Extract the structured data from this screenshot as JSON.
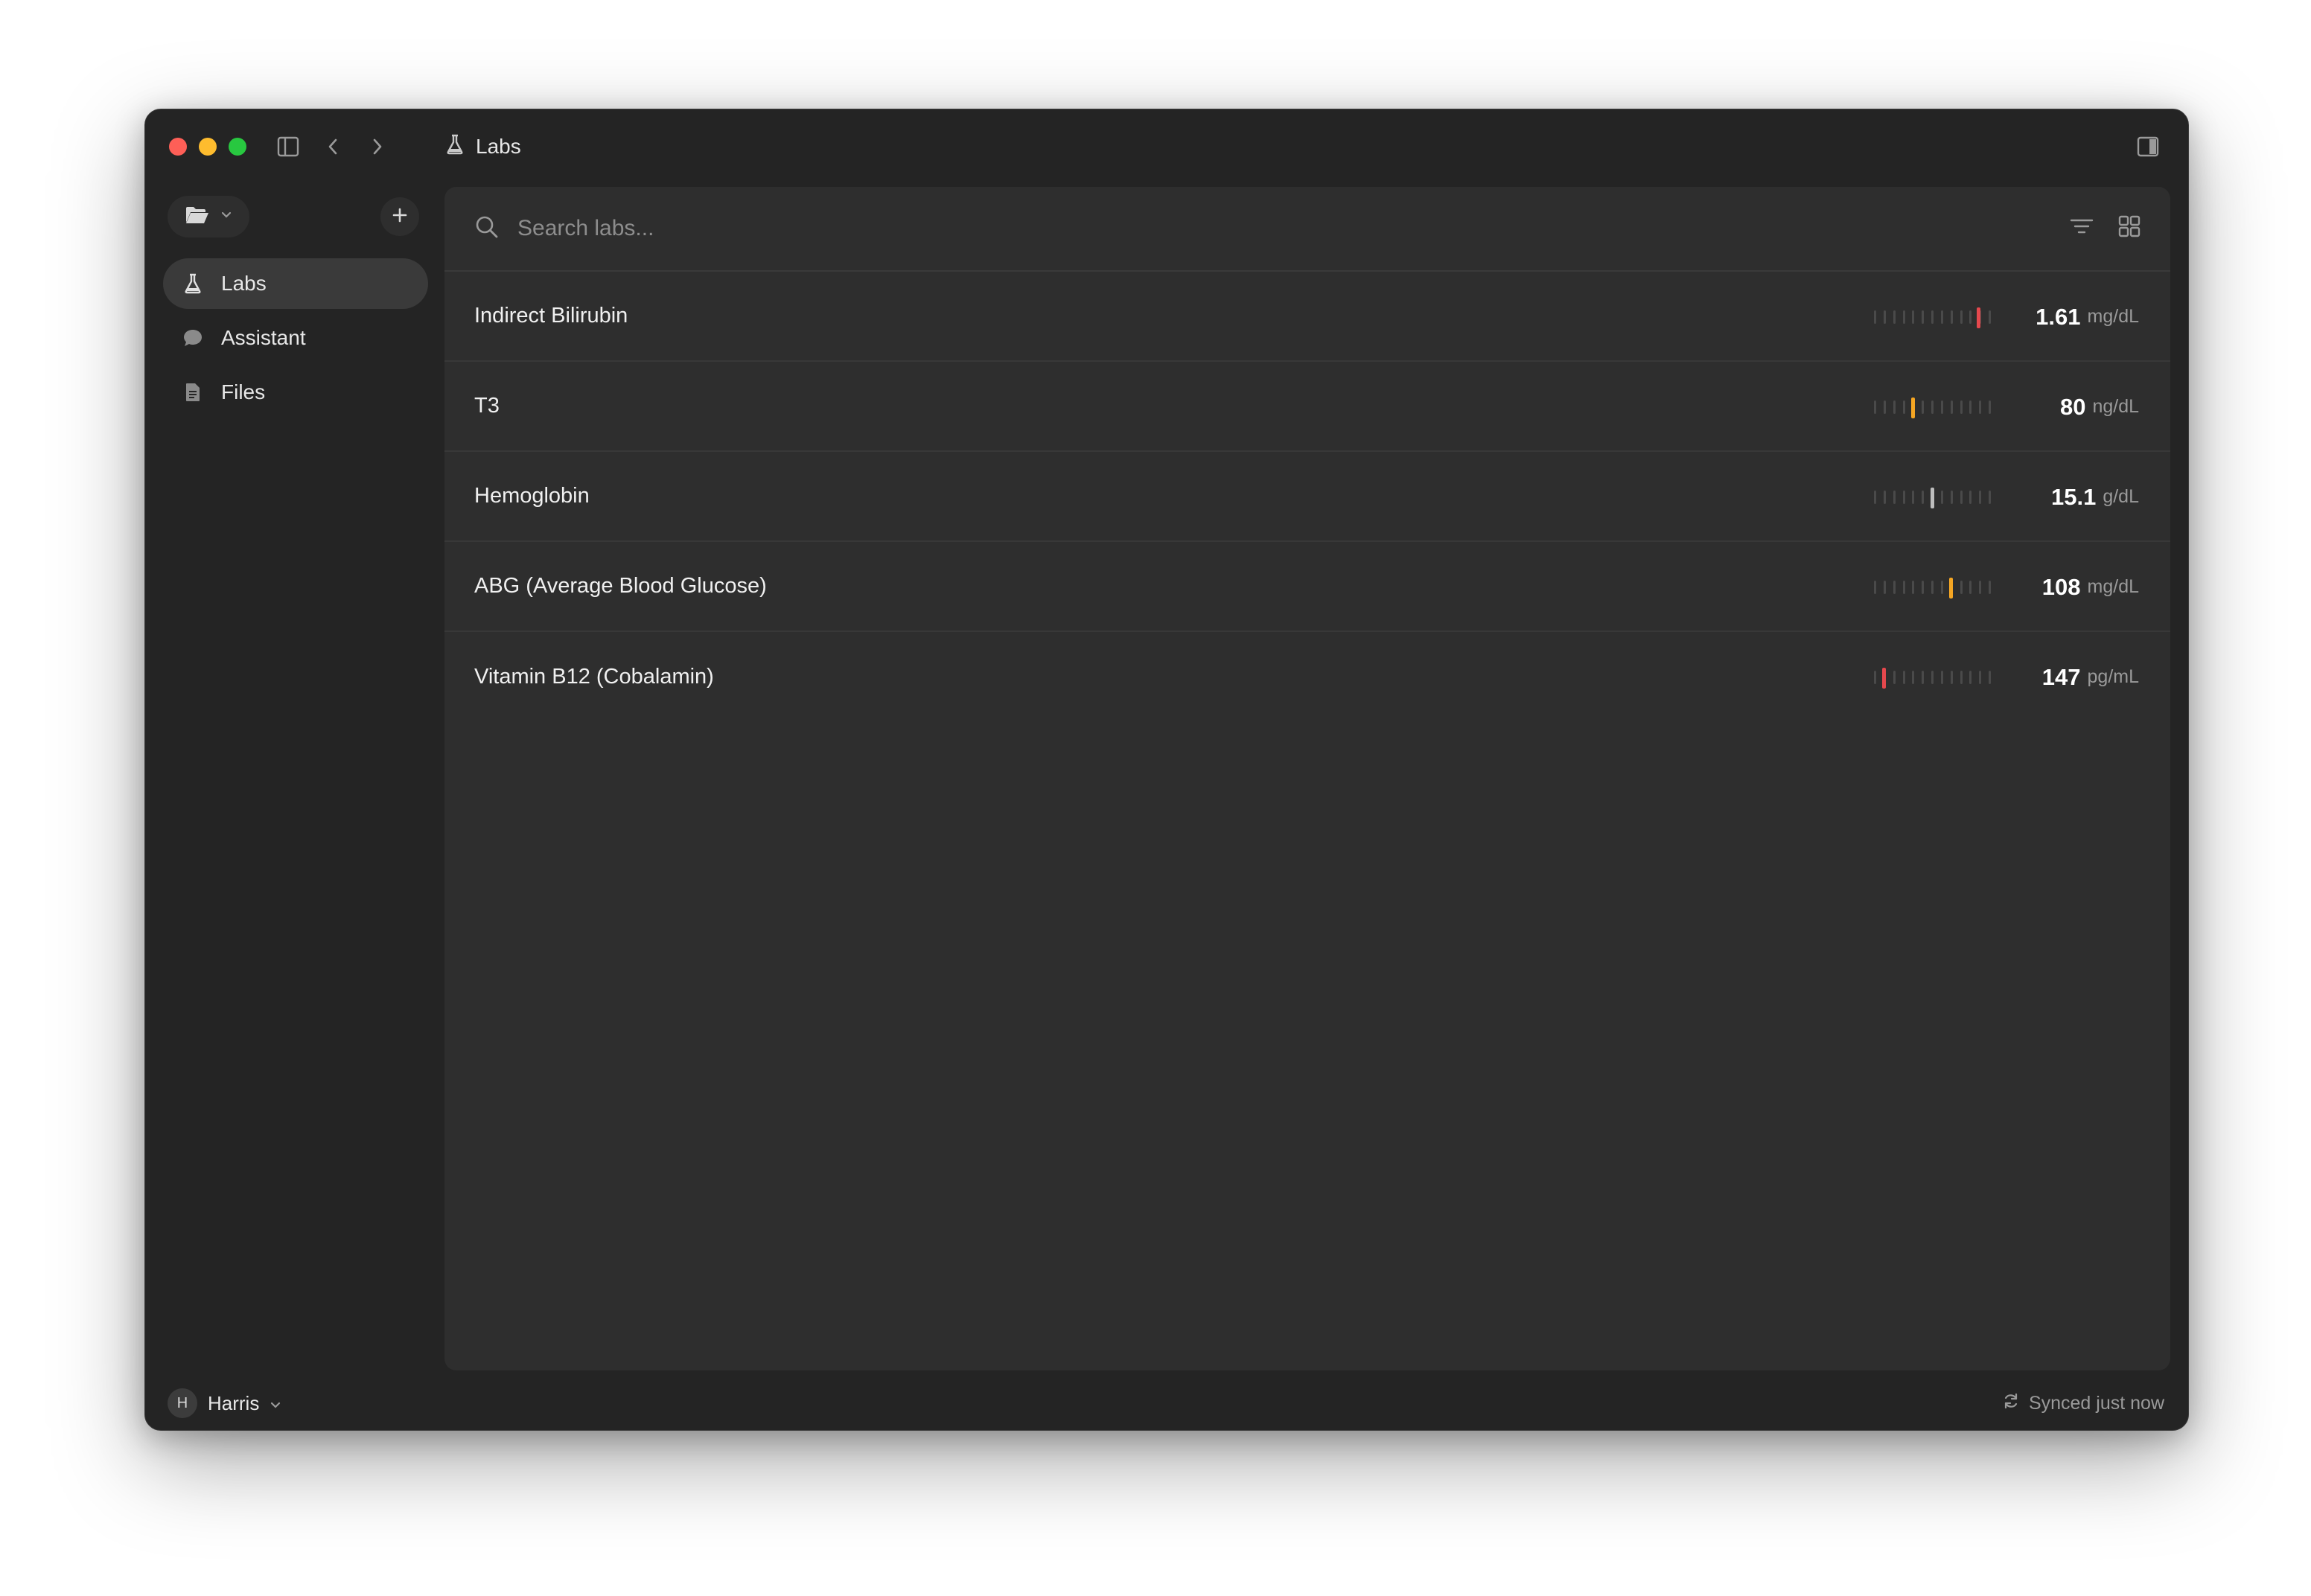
{
  "window": {
    "title": "Labs",
    "title_icon": "flask-icon"
  },
  "toolbar": {
    "sidebar_toggle_icon": "sidebar-icon",
    "back_icon": "chevron-left-icon",
    "forward_icon": "chevron-right-icon",
    "right_panel_icon": "panel-right-icon"
  },
  "sidebar": {
    "folder_icon": "folder-open-icon",
    "add_icon": "plus-icon",
    "items": [
      {
        "label": "Labs",
        "icon": "flask-icon",
        "active": true
      },
      {
        "label": "Assistant",
        "icon": "chat-bubble-icon",
        "active": false
      },
      {
        "label": "Files",
        "icon": "document-icon",
        "active": false
      }
    ]
  },
  "search": {
    "placeholder": "Search labs...",
    "value": ""
  },
  "labs": [
    {
      "name": "Indirect Bilirubin",
      "value": "1.61",
      "unit": "mg/dL",
      "gauge_position": 0.9,
      "status_color": "#e5484d"
    },
    {
      "name": "T3",
      "value": "80",
      "unit": "ng/dL",
      "gauge_position": 0.33,
      "status_color": "#f5a623"
    },
    {
      "name": "Hemoglobin",
      "value": "15.1",
      "unit": "g/dL",
      "gauge_position": 0.5,
      "status_color": "#bdbdbd"
    },
    {
      "name": "ABG (Average Blood Glucose)",
      "value": "108",
      "unit": "mg/dL",
      "gauge_position": 0.66,
      "status_color": "#f5a623"
    },
    {
      "name": "Vitamin B12 (Cobalamin)",
      "value": "147",
      "unit": "pg/mL",
      "gauge_position": 0.08,
      "status_color": "#e5484d"
    }
  ],
  "footer": {
    "user_initial": "H",
    "user_name": "Harris",
    "sync_status": "Synced just now"
  },
  "colors": {
    "window_bg": "#242424",
    "panel_bg": "#2e2e2e",
    "alert_red": "#e5484d",
    "warn_orange": "#f5a623",
    "normal_gray": "#bdbdbd"
  }
}
